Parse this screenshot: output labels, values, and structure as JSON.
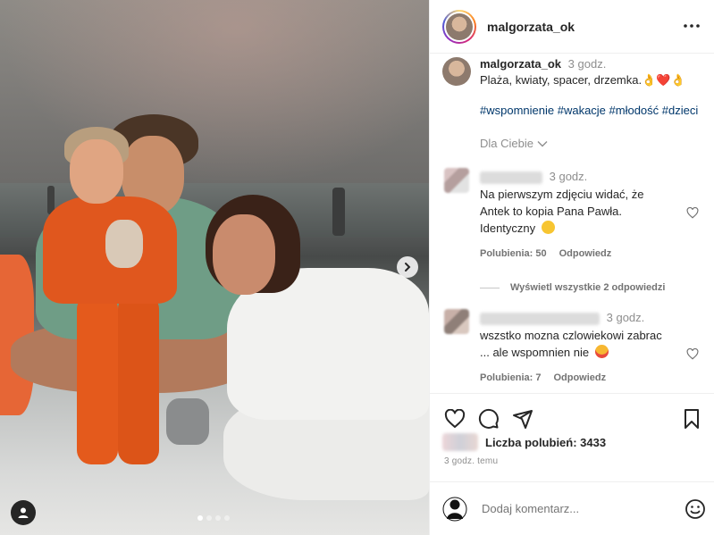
{
  "post": {
    "username": "malgorzata_ok",
    "caption": {
      "username": "malgorzata_ok",
      "time": "3 godz.",
      "text": "Plaża, kwiaty, spacer, drzemka.👌❤️👌",
      "hashtags": "#wspomnienie #wakacje #młodość #dzieci"
    },
    "for_you_label": "Dla Ciebie",
    "comments": [
      {
        "time": "3 godz.",
        "text": "Na pierwszym zdjęciu widać, że Antek to kopia Pana Pawła. Identyczny",
        "likes_label": "Polubienia: 50",
        "reply_label": "Odpowiedz"
      },
      {
        "time": "3 godz.",
        "text": "wszstko mozna czlowiekowi zabrac ... ale wspomnien nie",
        "likes_label": "Polubienia: 7",
        "reply_label": "Odpowiedz"
      }
    ],
    "view_replies_label": "Wyświetl wszystkie 2 odpowiedzi",
    "likes_text": "Liczba polubień: 3433",
    "posted_ago": "3 godz. temu",
    "comment_placeholder": "Dodaj komentarz...",
    "carousel": {
      "total": 4,
      "current": 1
    }
  },
  "icons": {
    "more": "more-horizontal-icon",
    "like": "heart-icon",
    "comment": "comment-icon",
    "share": "share-icon",
    "save": "bookmark-icon",
    "next": "chevron-right-icon",
    "user_tag": "user-icon",
    "emoji": "smile-icon"
  },
  "colors": {
    "hashtag": "#00376b",
    "muted": "#8e8e8e",
    "accent_orange": "#e0571e"
  }
}
